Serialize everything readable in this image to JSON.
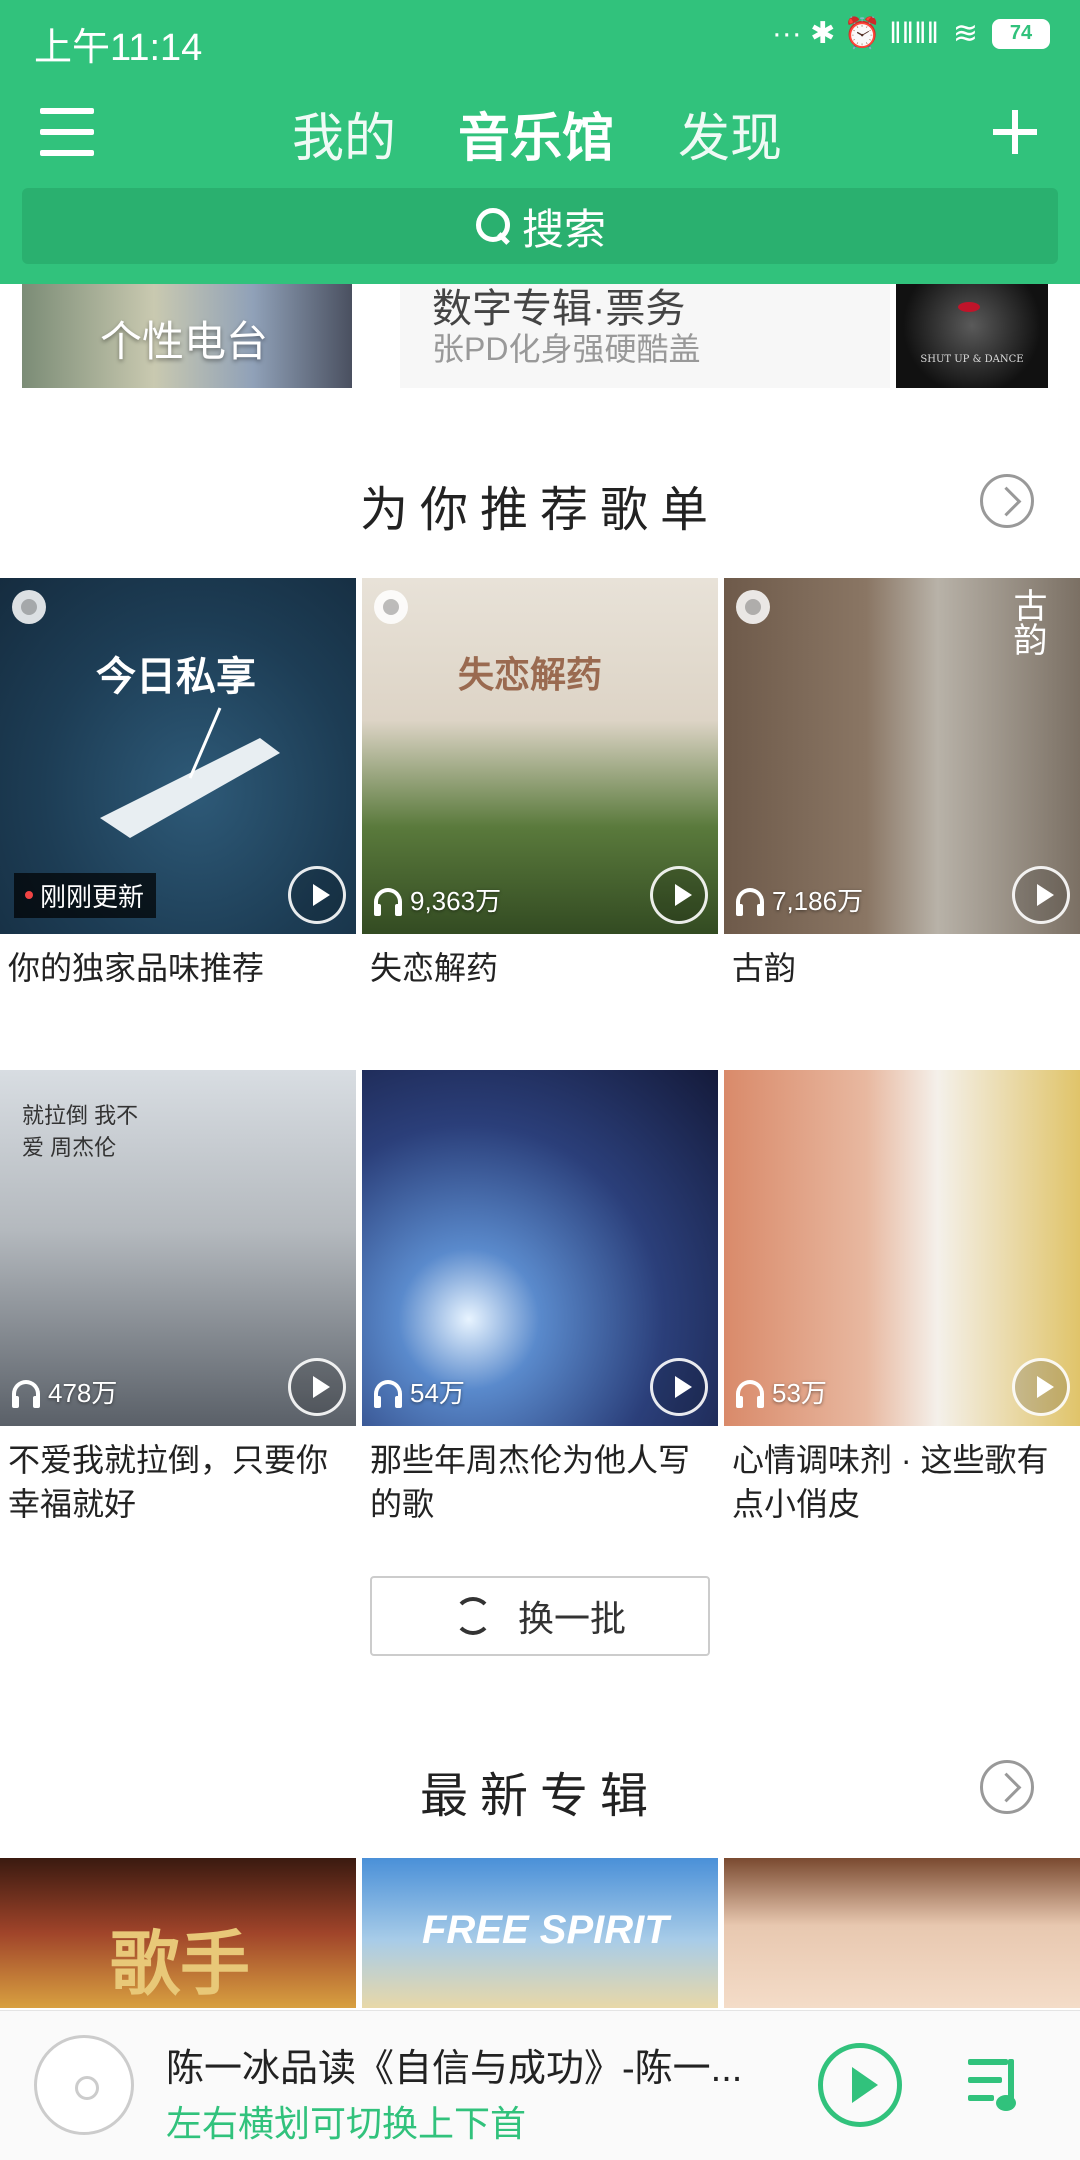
{
  "status_bar": {
    "time": "上午11:14",
    "icons_text": "··· ✱ ⏰ ‖‖‖‖",
    "battery": "74"
  },
  "nav": {
    "tabs": [
      {
        "label": "我的"
      },
      {
        "label": "音乐馆"
      },
      {
        "label": "发现"
      }
    ],
    "active_tab": "音乐馆"
  },
  "search": {
    "placeholder": "搜索"
  },
  "banner": {
    "left_label": "个性电台",
    "mid_title": "数字专辑·票务",
    "mid_subtitle": "张PD化身强硬酷盖",
    "right_caption": "SHUT UP & DANCE"
  },
  "recommend": {
    "title": "为你推荐歌单",
    "playlists": [
      {
        "cover_text": "今日私享",
        "badge": "刚刚更新",
        "title": "你的独家品味推荐"
      },
      {
        "cover_text": "失恋解药",
        "plays": "9,363万",
        "title": "失恋解药"
      },
      {
        "cover_text": "古韵",
        "plays": "7,186万",
        "title": "古韵"
      },
      {
        "cover_text": "就拉倒 我不爱 周杰伦",
        "plays": "478万",
        "title": "不爱我就拉倒，只要你幸福就好"
      },
      {
        "plays": "54万",
        "title": "那些年周杰伦为他人写的歌"
      },
      {
        "plays": "53万",
        "title": "心情调味剂 · 这些歌有点小俏皮"
      }
    ],
    "refresh_label": "换一批"
  },
  "new_albums": {
    "title": "最新专辑",
    "albums": [
      {
        "cover_text": "歌手"
      },
      {
        "cover_text": "FREE SPIRIT"
      },
      {
        "cover_text": ""
      }
    ]
  },
  "player": {
    "title": "陈一冰品读《自信与成功》-陈一...",
    "hint": "左右横划可切换上下首"
  },
  "colors": {
    "brand": "#31c27c",
    "search_bg": "#2ab06f"
  }
}
